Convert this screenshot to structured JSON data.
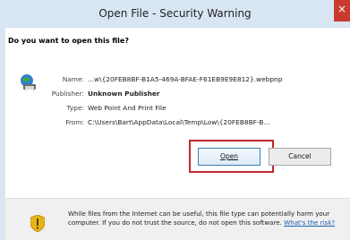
{
  "window": {
    "title": "Open File - Security Warning",
    "close_glyph": "×"
  },
  "dialog": {
    "question": "Do you want to open this file?",
    "file_icon": "web-point-and-print-icon",
    "fields": {
      "name_label": "Name:",
      "name_value": "...w\\{20FEB8BF-B1A5-469A-BFAE-F61EB9E9E812}.webpnp",
      "publisher_label": "Publisher:",
      "publisher_value": "Unknown Publisher",
      "type_label": "Type:",
      "type_value": "Web Point And Print File",
      "from_label": "From:",
      "from_value": "C:\\Users\\Bart\\AppData\\Local\\Temp\\Low\\{20FEB8BF-B..."
    },
    "buttons": {
      "open_label": "Open",
      "cancel_label": "Cancel"
    },
    "highlight_color": "#c1272d"
  },
  "warning": {
    "icon": "shield-warning-icon",
    "text": "While files from the Internet can be useful, this file type can potentially harm your computer. If you do not trust the source, do not open this software.",
    "link_text": "What's the risk?",
    "link_color": "#1a5fb4"
  }
}
